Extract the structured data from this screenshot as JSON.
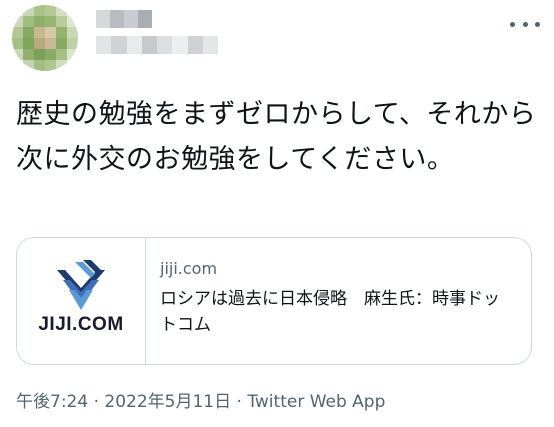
{
  "tweet": {
    "text": "歴史の勉強をまずゼロからして、それから次に外交のお勉強をしてください。",
    "timestamp": "午後7:24 · 2022年5月11日",
    "separator": " · ",
    "app": "Twitter Web App"
  },
  "author": {
    "avatar_colors": [
      "#a8c48c",
      "#9ab97a",
      "#c9d8b0",
      "#e4ebd8",
      "#7fa661",
      "#b7cc9c"
    ],
    "name_obscured": true
  },
  "link_card": {
    "domain": "jiji.com",
    "title": "ロシアは過去に日本侵略　麻生氏：時事ドットコム",
    "brand": "JIJI.COM"
  },
  "colors": {
    "text": "#0f1419",
    "secondary": "#536471",
    "border": "#cfd9de",
    "logo_dark": "#1e3a6e",
    "logo_light": "#5b9bd5"
  }
}
